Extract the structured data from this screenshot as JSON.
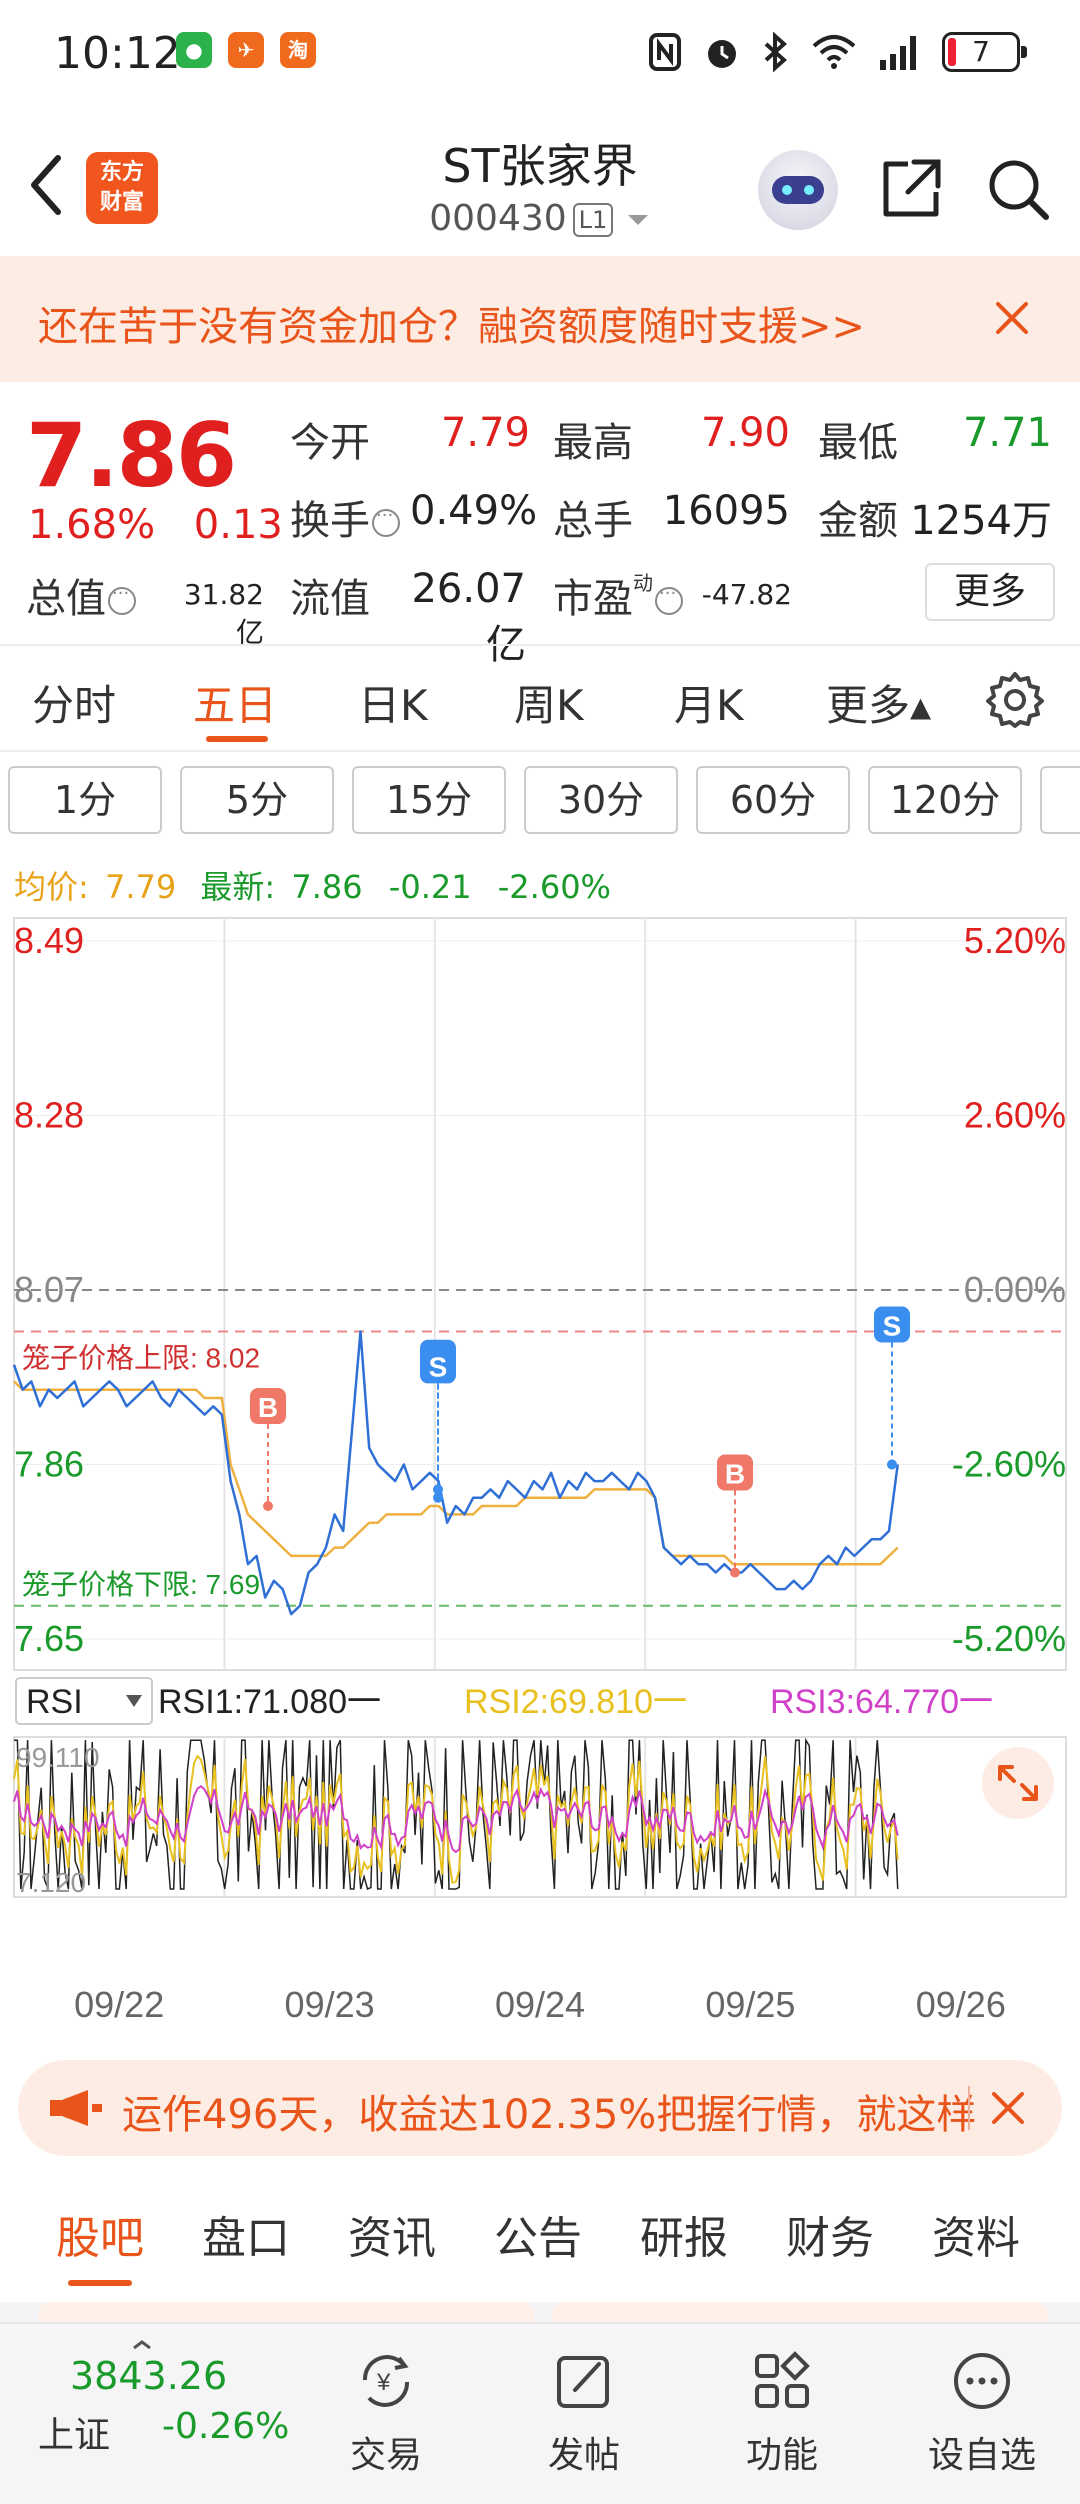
{
  "status_bar": {
    "time": "10:12",
    "battery": "7",
    "notif_app3": "淘"
  },
  "header": {
    "logo_line1": "东方",
    "logo_line2": "财富",
    "stock_name": "ST张家界",
    "stock_code": "000430",
    "code_badge": "L1"
  },
  "promo_banner": {
    "text": "还在苦于没有资金加仓？融资额度随时支援>>"
  },
  "quote": {
    "price": "7.86",
    "change_pct": "1.68%",
    "change_amt": "0.13",
    "open_label": "今开",
    "open_value": "7.79",
    "high_label": "最高",
    "high_value": "7.90",
    "low_label": "最低",
    "low_value": "7.71",
    "turnover_label": "换手",
    "turnover_value": "0.49%",
    "volume_label": "总手",
    "volume_value": "16095",
    "amount_label": "金额",
    "amount_value": "1254万",
    "mktcap_label": "总值",
    "mktcap_value": "31.82亿",
    "float_label": "流值",
    "float_value": "26.07亿",
    "pe_label": "市盈",
    "pe_sup": "动",
    "pe_value": "-47.82",
    "more_label": "更多"
  },
  "period_tabs": [
    "分时",
    "五日",
    "日K",
    "周K",
    "月K",
    "更多▴"
  ],
  "intervals": [
    "1分",
    "5分",
    "15分",
    "30分",
    "60分",
    "120分"
  ],
  "avg_line": {
    "avg_label": "均价:",
    "avg_value": "7.79",
    "latest_label": "最新:",
    "latest_value": "7.86",
    "chg": "-0.21",
    "chg_pct": "-2.60%"
  },
  "chart_data": {
    "type": "line",
    "x_dates": [
      "09/22",
      "09/23",
      "09/24",
      "09/25",
      "09/26"
    ],
    "y_left_ticks": [
      "8.49",
      "8.28",
      "8.07",
      "7.86",
      "7.65"
    ],
    "y_right_ticks": [
      "5.20%",
      "2.60%",
      "0.00%",
      "-2.60%",
      "-5.20%"
    ],
    "ylim": [
      7.65,
      8.49
    ],
    "prev_close": 8.07,
    "limit_up_label": "笼子价格上限:",
    "limit_up_value": "8.02",
    "limit_down_label": "笼子价格下限:",
    "limit_down_value": "7.69",
    "markers": [
      {
        "label": "B",
        "day": 1,
        "price": 7.81
      },
      {
        "label": "S",
        "day": 2,
        "price": 7.82
      },
      {
        "label": "S",
        "day": 2,
        "price": 7.83
      },
      {
        "label": "B",
        "day": 4,
        "price": 7.73
      },
      {
        "label": "S",
        "day": 5,
        "price": 7.86
      }
    ],
    "series": [
      {
        "name": "price",
        "color": "#2f6fd6",
        "values": [
          7.98,
          7.95,
          7.96,
          7.93,
          7.95,
          7.94,
          7.95,
          7.96,
          7.93,
          7.94,
          7.95,
          7.96,
          7.95,
          7.93,
          7.94,
          7.95,
          7.96,
          7.94,
          7.93,
          7.95,
          7.94,
          7.93,
          7.92,
          7.93,
          7.92,
          7.84,
          7.8,
          7.74,
          7.75,
          7.7,
          7.72,
          7.71,
          7.68,
          7.69,
          7.73,
          7.74,
          7.76,
          7.8,
          7.78,
          7.9,
          8.02,
          7.88,
          7.86,
          7.85,
          7.84,
          7.86,
          7.83,
          7.84,
          7.85,
          7.84,
          7.79,
          7.81,
          7.8,
          7.82,
          7.82,
          7.83,
          7.82,
          7.84,
          7.83,
          7.82,
          7.84,
          7.83,
          7.85,
          7.82,
          7.84,
          7.83,
          7.85,
          7.84,
          7.84,
          7.85,
          7.84,
          7.83,
          7.85,
          7.84,
          7.82,
          7.76,
          7.75,
          7.74,
          7.75,
          7.74,
          7.74,
          7.73,
          7.74,
          7.73,
          7.73,
          7.74,
          7.73,
          7.72,
          7.71,
          7.71,
          7.72,
          7.71,
          7.72,
          7.74,
          7.75,
          7.74,
          7.76,
          7.75,
          7.76,
          7.77,
          7.77,
          7.78,
          7.86
        ]
      },
      {
        "name": "avg",
        "color": "#f0b040",
        "values": [
          7.96,
          7.95,
          7.95,
          7.95,
          7.95,
          7.95,
          7.95,
          7.95,
          7.95,
          7.95,
          7.95,
          7.95,
          7.95,
          7.95,
          7.95,
          7.95,
          7.95,
          7.95,
          7.95,
          7.95,
          7.95,
          7.95,
          7.94,
          7.94,
          7.94,
          7.86,
          7.83,
          7.8,
          7.79,
          7.78,
          7.77,
          7.76,
          7.75,
          7.75,
          7.75,
          7.75,
          7.75,
          7.76,
          7.76,
          7.77,
          7.78,
          7.79,
          7.79,
          7.8,
          7.8,
          7.8,
          7.8,
          7.8,
          7.81,
          7.81,
          7.8,
          7.8,
          7.8,
          7.8,
          7.81,
          7.81,
          7.81,
          7.81,
          7.81,
          7.82,
          7.82,
          7.82,
          7.82,
          7.82,
          7.82,
          7.82,
          7.82,
          7.83,
          7.83,
          7.83,
          7.83,
          7.83,
          7.83,
          7.83,
          7.82,
          7.76,
          7.75,
          7.75,
          7.75,
          7.75,
          7.75,
          7.75,
          7.75,
          7.74,
          7.74,
          7.74,
          7.74,
          7.74,
          7.74,
          7.74,
          7.74,
          7.74,
          7.74,
          7.74,
          7.74,
          7.74,
          7.74,
          7.74,
          7.74,
          7.74,
          7.74,
          7.75,
          7.76
        ]
      }
    ],
    "rsi": {
      "select_label": "RSI",
      "rsi1_label": "RSI1:71.080一",
      "rsi2_label": "RSI2:69.810一",
      "rsi3_label": "RSI3:64.770一",
      "top_label": "99.110",
      "bottom_label": "7.120",
      "colors": {
        "rsi1": "#222222",
        "rsi2": "#e8c020",
        "rsi3": "#d040c8"
      }
    }
  },
  "promo2": {
    "text": "运作496天，收益达102.35%把握行情，就这样"
  },
  "bottom_tabs": [
    "股吧",
    "盘口",
    "资讯",
    "公告",
    "研报",
    "财务",
    "资料"
  ],
  "bottom_nav": {
    "index_value": "3843.26",
    "index_name": "上证",
    "index_change": "-0.26%",
    "items": [
      "交易",
      "发帖",
      "功能",
      "设自选"
    ]
  },
  "colors": {
    "accent": "#e8541a",
    "up": "#e0201f",
    "down": "#1a9a2a",
    "price_line": "#2f6fd6",
    "avg_line": "#f0b040"
  }
}
